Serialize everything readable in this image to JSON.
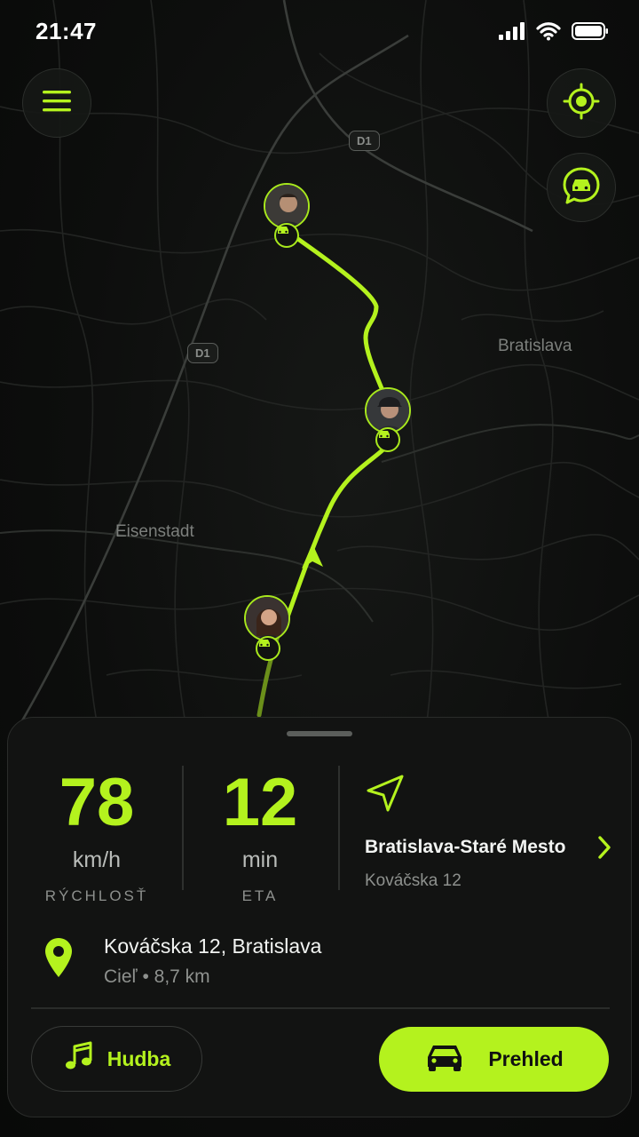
{
  "status_bar": {
    "time": "21:47"
  },
  "map": {
    "labels": {
      "city_right": "Bratislava",
      "city_left": "Eisenstadt"
    },
    "road_shields": [
      "D1",
      "D1"
    ]
  },
  "controls": {
    "menu_icon": "menu-icon",
    "locate_icon": "crosshair-icon",
    "chat_icon": "car-chat-icon"
  },
  "stats": {
    "speed": {
      "value": "78",
      "unit": "km/h",
      "label": "RÝCHLOSŤ"
    },
    "eta": {
      "value": "12",
      "unit": "min",
      "label": "ETA"
    }
  },
  "navigation": {
    "title": "Bratislava-Staré Mesto",
    "subtitle": "Kováčska 12"
  },
  "destination": {
    "title": "Kováčska 12, Bratislava",
    "subtitle": "Cieľ  •  8,7 km"
  },
  "buttons": {
    "music": "Hudba",
    "overview": "Prehled"
  },
  "colors": {
    "accent": "#b4f21e",
    "background": "#0a0b0a",
    "sheet": "#121312"
  }
}
